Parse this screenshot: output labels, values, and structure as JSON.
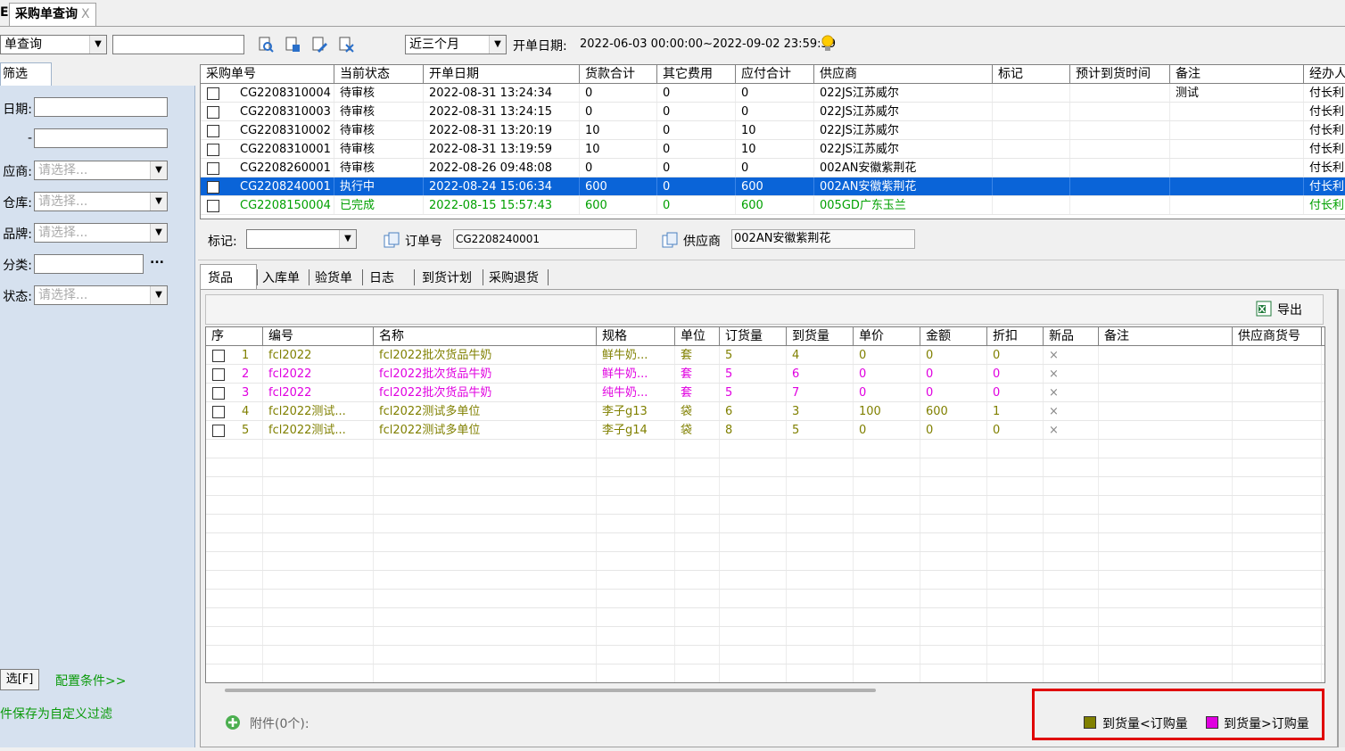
{
  "tabs": [
    {
      "label": "采购单查询",
      "close": "X"
    }
  ],
  "tab_left_fragment": "E",
  "toolbar": {
    "query_combo": "单查询",
    "search_value": "",
    "period_combo": "近三个月",
    "date_label": "开单日期:",
    "date_range": "2022-06-03 00:00:00~2022-09-02 23:59:59"
  },
  "filter_panel": {
    "tab_label": "筛选",
    "date_label": "日期:",
    "dash": "-",
    "supplier_label": "应商:",
    "warehouse_label": "仓库:",
    "brand_label": "品牌:",
    "category_label": "分类:",
    "status_label": "状态:",
    "placeholder": "请选择...",
    "more": "...",
    "filter_button": "选[F]",
    "config_link": "配置条件>>",
    "save_link": "件保存为自定义过滤"
  },
  "orders": {
    "columns": [
      "采购单号",
      "当前状态",
      "开单日期",
      "货款合计",
      "其它费用",
      "应付合计",
      "供应商",
      "标记",
      "预计到货时间",
      "备注",
      "经办人"
    ],
    "rows": [
      {
        "no": "CG2208310004",
        "status": "待审核",
        "date": "2022-08-31 13:24:34",
        "goods": "0",
        "other": "0",
        "payable": "0",
        "supplier": "022JS江苏威尔",
        "mark": "",
        "eta": "",
        "note": "测试",
        "handler": "付长利",
        "style": "normal"
      },
      {
        "no": "CG2208310003",
        "status": "待审核",
        "date": "2022-08-31 13:24:15",
        "goods": "0",
        "other": "0",
        "payable": "0",
        "supplier": "022JS江苏威尔",
        "mark": "",
        "eta": "",
        "note": "",
        "handler": "付长利",
        "style": "normal"
      },
      {
        "no": "CG2208310002",
        "status": "待审核",
        "date": "2022-08-31 13:20:19",
        "goods": "10",
        "other": "0",
        "payable": "10",
        "supplier": "022JS江苏威尔",
        "mark": "",
        "eta": "",
        "note": "",
        "handler": "付长利",
        "style": "normal"
      },
      {
        "no": "CG2208310001",
        "status": "待审核",
        "date": "2022-08-31 13:19:59",
        "goods": "10",
        "other": "0",
        "payable": "10",
        "supplier": "022JS江苏威尔",
        "mark": "",
        "eta": "",
        "note": "",
        "handler": "付长利",
        "style": "normal"
      },
      {
        "no": "CG2208260001",
        "status": "待审核",
        "date": "2022-08-26 09:48:08",
        "goods": "0",
        "other": "0",
        "payable": "0",
        "supplier": "002AN安徽紫荆花",
        "mark": "",
        "eta": "",
        "note": "",
        "handler": "付长利",
        "style": "normal"
      },
      {
        "no": "CG2208240001",
        "status": "执行中",
        "date": "2022-08-24 15:06:34",
        "goods": "600",
        "other": "0",
        "payable": "600",
        "supplier": "002AN安徽紫荆花",
        "mark": "",
        "eta": "",
        "note": "",
        "handler": "付长利",
        "style": "selected"
      },
      {
        "no": "CG2208150004",
        "status": "已完成",
        "date": "2022-08-15 15:57:43",
        "goods": "600",
        "other": "0",
        "payable": "600",
        "supplier": "005GD广东玉兰",
        "mark": "",
        "eta": "",
        "note": "",
        "handler": "付长利",
        "style": "green"
      }
    ]
  },
  "detail_bar": {
    "mark_label": "标记:",
    "mark_value": "",
    "order_label": "订单号",
    "order_value": "CG2208240001",
    "supplier_label": "供应商",
    "supplier_value": "002AN安徽紫荆花"
  },
  "subtabs": [
    "货品",
    "入库单",
    "验货单",
    "日志",
    "到货计划",
    "采购退货"
  ],
  "export_label": "导出",
  "items": {
    "columns": [
      "序",
      "编号",
      "名称",
      "规格",
      "单位",
      "订货量",
      "到货量",
      "单价",
      "金额",
      "折扣",
      "新品",
      "备注",
      "供应商货号"
    ],
    "rows": [
      {
        "seq": "1",
        "code": "fcl2022",
        "name": "fcl2022批次货品牛奶",
        "spec": "鲜牛奶...",
        "unit": "套",
        "ordered": "5",
        "received": "4",
        "price": "0",
        "amount": "0",
        "discount": "0",
        "new": "×",
        "note": "",
        "supplier_code": "",
        "color": "olive"
      },
      {
        "seq": "2",
        "code": "fcl2022",
        "name": "fcl2022批次货品牛奶",
        "spec": "鲜牛奶...",
        "unit": "套",
        "ordered": "5",
        "received": "6",
        "price": "0",
        "amount": "0",
        "discount": "0",
        "new": "×",
        "note": "",
        "supplier_code": "",
        "color": "magenta"
      },
      {
        "seq": "3",
        "code": "fcl2022",
        "name": "fcl2022批次货品牛奶",
        "spec": "纯牛奶...",
        "unit": "套",
        "ordered": "5",
        "received": "7",
        "price": "0",
        "amount": "0",
        "discount": "0",
        "new": "×",
        "note": "",
        "supplier_code": "",
        "color": "magenta"
      },
      {
        "seq": "4",
        "code": "fcl2022测试...",
        "name": "fcl2022测试多单位",
        "spec": "李子g13",
        "unit": "袋",
        "ordered": "6",
        "received": "3",
        "price": "100",
        "amount": "600",
        "discount": "1",
        "new": "×",
        "note": "",
        "supplier_code": "",
        "color": "olive"
      },
      {
        "seq": "5",
        "code": "fcl2022测试...",
        "name": "fcl2022测试多单位",
        "spec": "李子g14",
        "unit": "袋",
        "ordered": "8",
        "received": "5",
        "price": "0",
        "amount": "0",
        "discount": "0",
        "new": "×",
        "note": "",
        "supplier_code": "",
        "color": "olive"
      }
    ]
  },
  "attachment_label": "附件(0个):",
  "legend": [
    {
      "label": "到货量<订购量",
      "color": "#808000"
    },
    {
      "label": "到货量>订购量",
      "color": "#e000e0"
    }
  ],
  "colors": {
    "selected": "#0a64d8",
    "highlight_box": "#e00000",
    "panel": "#d6e1ef"
  }
}
